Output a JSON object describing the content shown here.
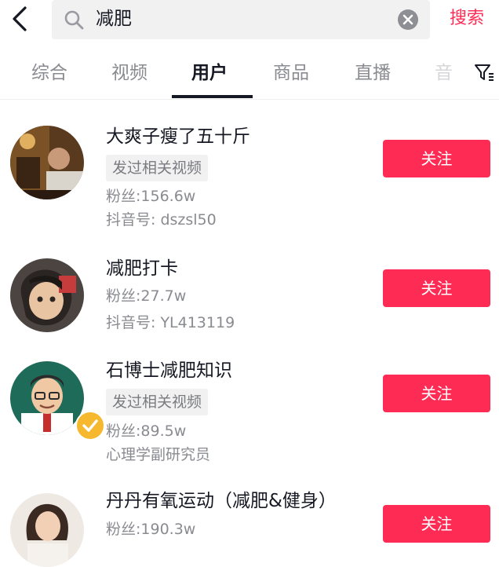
{
  "search": {
    "query": "减肥",
    "button": "搜索"
  },
  "tabs": [
    {
      "label": "综合"
    },
    {
      "label": "视频"
    },
    {
      "label": "用户",
      "active": true
    },
    {
      "label": "商品"
    },
    {
      "label": "直播"
    },
    {
      "label": "音"
    }
  ],
  "users": [
    {
      "name": "大爽子瘦了五十斤",
      "tag": "发过相关视频",
      "fans": "粉丝:156.6w",
      "extra": "抖音号: dszsl50",
      "button": "关注"
    },
    {
      "name": "减肥打卡",
      "fans": "粉丝:27.7w",
      "extra": "抖音号: YL413119",
      "button": "关注"
    },
    {
      "name": "石博士减肥知识",
      "tag": "发过相关视频",
      "fans": "粉丝:89.5w",
      "extra": "心理学副研究员",
      "button": "关注",
      "verified": true
    },
    {
      "name": "丹丹有氧运动（减肥&健身）",
      "fans": "粉丝:190.3w",
      "button": "关注"
    }
  ],
  "colors": {
    "accent": "#fe2c55",
    "text": "#161823",
    "muted": "#8a8b91",
    "tag_bg": "#f1f1f2"
  },
  "icons": [
    "back-arrow-icon",
    "search-icon",
    "clear-icon",
    "filter-icon",
    "verified-badge-icon"
  ]
}
